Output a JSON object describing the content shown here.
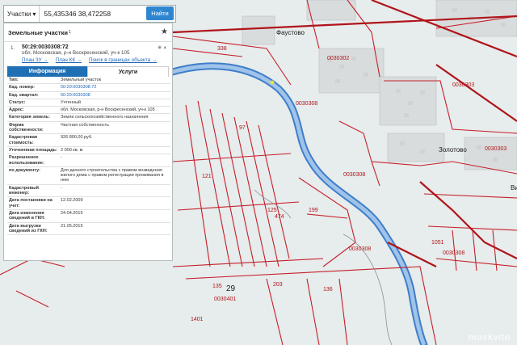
{
  "search": {
    "mode": "Участки",
    "query": "55,435346 38,472258",
    "button": "Найти"
  },
  "panel": {
    "title": "Земельные участки",
    "count": "1",
    "result": {
      "index": "1.",
      "number": "50:29:0030308:72",
      "address": "обл. Московская, р-н Воскресенский, уч-к 105",
      "links": [
        "План ЗУ →",
        "План КК →",
        "Поиск в границах объекта →"
      ]
    },
    "tabs": [
      "Информация",
      "Услуги"
    ],
    "rows": [
      {
        "k": "Тип:",
        "v": "Земельный участок"
      },
      {
        "k": "Кад. номер:",
        "v": "50:29:0030308:72"
      },
      {
        "k": "Кад. квартал:",
        "v": "50:29:0030308"
      },
      {
        "k": "Статус:",
        "v": "Учтенный"
      },
      {
        "k": "Адрес:",
        "v": "обл. Московская, р-н Воскресенский, уч-к 105"
      },
      {
        "k": "Категория земель:",
        "v": "Земли сельскохозяйственного назначения"
      },
      {
        "k": "Форма собственности:",
        "v": "Частная собственность"
      },
      {
        "k": "Кадастровая стоимость:",
        "v": "926 800,00 руб."
      },
      {
        "k": "Уточненная площадь:",
        "v": "2 000 кв. м"
      },
      {
        "k": "Разрешенное использование:",
        "v": "-"
      },
      {
        "k": "по документу:",
        "v": "Для дачного строительства с правом возведения жилого дома с правом регистрации проживания в нем"
      },
      {
        "k": "Кадастровый инженер:",
        "v": "-"
      },
      {
        "k": "Дата постановки на учет:",
        "v": "12.02.2009"
      },
      {
        "k": "Дата изменения сведений в ГКН:",
        "v": "24.04.2015"
      },
      {
        "k": "Дата выгрузки сведений из ГКН:",
        "v": "21.05.2015"
      }
    ]
  },
  "map": {
    "labels": {
      "faustovo": "Фаустово",
      "zolotovo": "Золотово",
      "vi": "Ви"
    },
    "parcels": {
      "q302": "0030302",
      "q303a": "0030303",
      "q303b": "0030303",
      "q308a": "0030308",
      "q308b": "0030308",
      "q308c": "0030308",
      "q308d": "0030308",
      "q401": "0030401",
      "n29": "29",
      "p338": "338",
      "p97": "97",
      "p121": "121",
      "p125": "125",
      "p474": "474",
      "p1051": "1051",
      "p135": "135",
      "p136": "136",
      "p1401": "1401",
      "p199": "199",
      "p203": "203"
    },
    "watermark": "moskvito"
  },
  "colors": {
    "parcel": "#c51f2a",
    "river": "#3f7ec9",
    "accent": "#1f6fb4"
  }
}
